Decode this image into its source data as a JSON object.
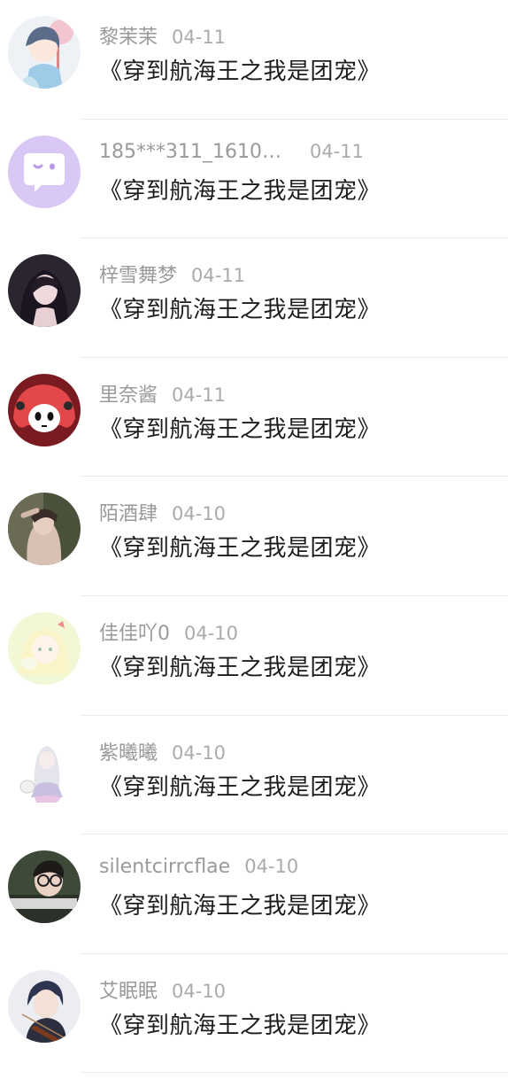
{
  "comments": [
    {
      "user": "黎茉茉",
      "date": "04-11",
      "text": "《穿到航海王之我是团宠》",
      "avatar_icon": "anime-girl-avatar",
      "avatar_color": "#d8e4f0"
    },
    {
      "user": "185***311_1610…",
      "date": "04-11",
      "text": "《穿到航海王之我是团宠》",
      "avatar_icon": "default-chat-avatar",
      "avatar_color": "#d6c4f5"
    },
    {
      "user": "梓雪舞梦",
      "date": "04-11",
      "text": "《穿到航海王之我是团宠》",
      "avatar_icon": "dark-hair-girl-avatar",
      "avatar_color": "#2a2430"
    },
    {
      "user": "里奈酱",
      "date": "04-11",
      "text": "《穿到航海王之我是团宠》",
      "avatar_icon": "red-hair-anime-avatar",
      "avatar_color": "#c7302f"
    },
    {
      "user": "陌酒肆",
      "date": "04-10",
      "text": "《穿到航海王之我是团宠》",
      "avatar_icon": "photo-girl-avatar",
      "avatar_color": "#4a5238"
    },
    {
      "user": "佳佳吖0",
      "date": "04-10",
      "text": "《穿到航海王之我是团宠》",
      "avatar_icon": "pastel-anime-avatar",
      "avatar_color": "#f3f7d4"
    },
    {
      "user": "紫曦曦",
      "date": "04-10",
      "text": "《穿到航海王之我是团宠》",
      "avatar_icon": "white-hair-anime-avatar",
      "avatar_color": "#f4f2f6"
    },
    {
      "user": "silentcirrcflae",
      "date": "04-10",
      "text": "《穿到航海王之我是团宠》",
      "avatar_icon": "glasses-boy-avatar",
      "avatar_color": "#3b3f3a"
    },
    {
      "user": "艾眠眠",
      "date": "04-10",
      "text": "《穿到航海王之我是团宠》",
      "avatar_icon": "violin-boy-avatar",
      "avatar_color": "#e9e9ee"
    }
  ]
}
